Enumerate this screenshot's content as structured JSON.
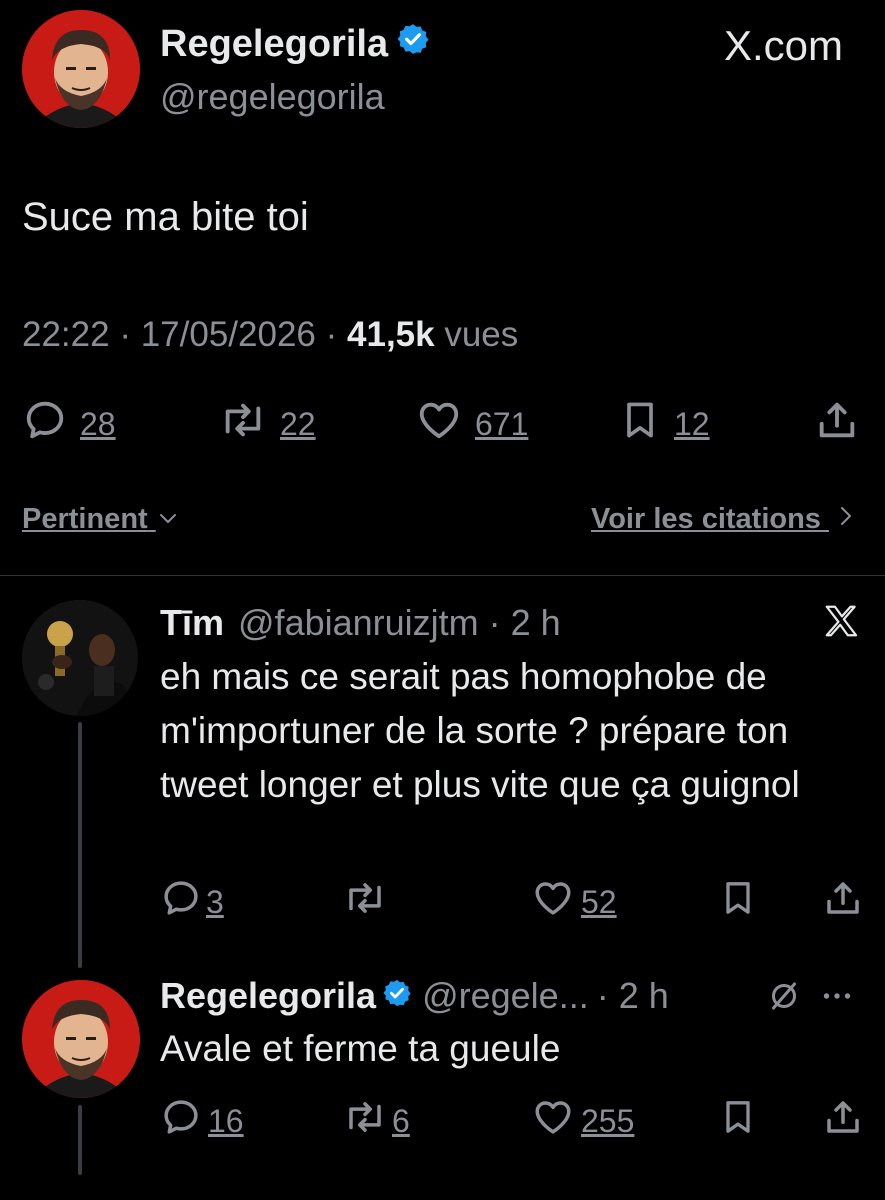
{
  "brand": "X.com",
  "main_tweet": {
    "display_name": "Regelegorila",
    "handle": "@regelegorila",
    "text": "Suce ma bite toi",
    "time": "22:22",
    "sep1": "·",
    "date": "17/05/2026",
    "sep2": "·",
    "views": "41,5k",
    "views_label": "vues",
    "replies": "28",
    "reposts": "22",
    "likes": "671",
    "bookmarks": "12"
  },
  "filters": {
    "sort_label": "Pertinent",
    "quotes_label": "Voir les citations"
  },
  "replies": [
    {
      "display_name": "Tīm",
      "handle": "@fabianruizjtm",
      "time": "· 2 h",
      "text": "eh mais ce serait pas homophobe de m'importuner de la sorte ? prépare ton tweet longer et plus vite que ça guignol",
      "replies": "3",
      "likes": "52"
    },
    {
      "display_name": "Regelegorila",
      "handle": "@regele...",
      "time": "· 2 h",
      "text": "Avale et ferme ta gueule",
      "replies": "16",
      "reposts": "6",
      "likes": "255"
    }
  ],
  "colors": {
    "background": "#000000",
    "text": "#e7e9ea",
    "muted": "#8b9096",
    "verified": "#1d9bf0",
    "avatar_red": "#c21a14"
  },
  "icons": [
    "verified-badge-icon",
    "reply-icon",
    "repost-icon",
    "like-icon",
    "bookmark-icon",
    "share-icon",
    "x-logo-icon",
    "chevron-down-icon",
    "chevron-right-icon",
    "grok-icon",
    "more-icon"
  ]
}
